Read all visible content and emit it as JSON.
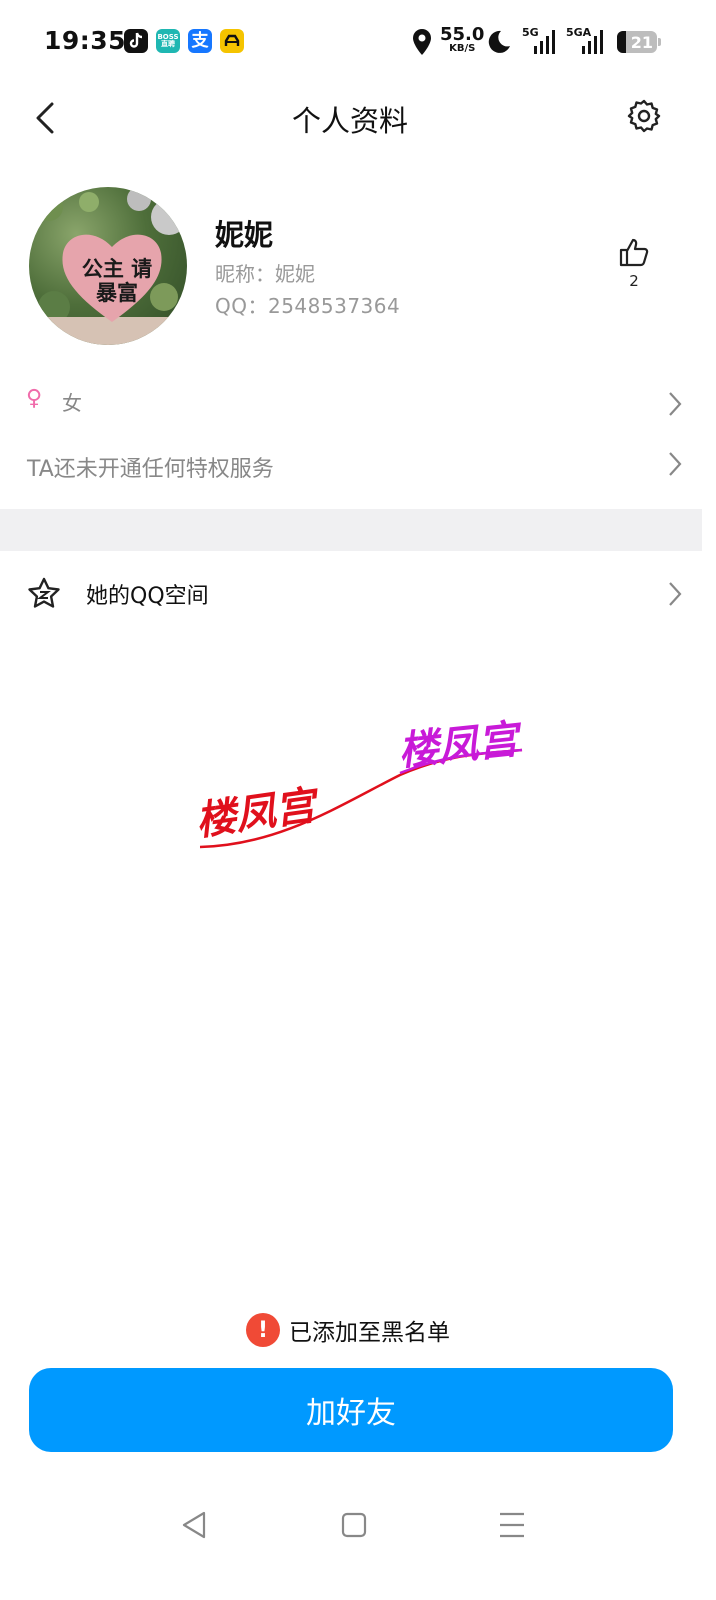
{
  "status_bar": {
    "time": "19:35",
    "apps": [
      {
        "name": "douyin-app-icon",
        "label": "",
        "color": "#111111"
      },
      {
        "name": "boss-app-icon",
        "label": "BOSS\n直聘",
        "color": "#1fb7b2"
      },
      {
        "name": "alipay-app-icon",
        "label": "支",
        "color": "#1677ff"
      },
      {
        "name": "car-app-icon",
        "label": "",
        "color": "#f5c400"
      }
    ],
    "net_speed": "55.0",
    "net_speed_unit": "KB/S",
    "net_type_1": "5G",
    "net_type_2": "5GA",
    "battery": "21"
  },
  "header": {
    "title": "个人资料",
    "back_icon": "chevron-left-icon",
    "settings_icon": "gear-icon"
  },
  "profile": {
    "display_name": "妮妮",
    "nickname": "昵称：妮妮",
    "qq": "QQ：2548537364",
    "avatar_text": "公主 请暴富",
    "like_count": "2"
  },
  "rows": {
    "gender_symbol": "♀",
    "gender": "女",
    "privilege": "TA还未开通任何特权服务",
    "qzone": "她的QQ空间"
  },
  "watermark": {
    "text_1": "楼凤宫",
    "text_2": "楼凤宫",
    "color_1": "#e0101c",
    "color_2": "#c81ad8"
  },
  "footer": {
    "notice_icon": "!",
    "notice": "已添加至黑名单",
    "add_friend": "加好友",
    "accent": "#0099ff"
  },
  "nav": {
    "back": "triangle-back-icon",
    "home": "square-home-icon",
    "menu": "menu-lines-icon"
  }
}
